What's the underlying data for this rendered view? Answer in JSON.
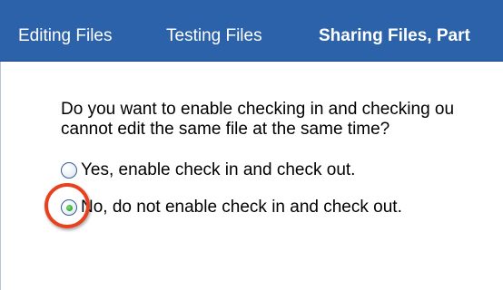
{
  "tabs": [
    {
      "label": "Editing Files",
      "active": false
    },
    {
      "label": "Testing Files",
      "active": false
    },
    {
      "label": "Sharing Files, Part",
      "active": true
    }
  ],
  "colors": {
    "tab_bar": "#2c62a9",
    "highlight_ring": "#e8411f",
    "radio_selected": "#2fa52f"
  },
  "question": {
    "line1": "Do you want to enable checking in and checking ou",
    "line2": "cannot edit the same file at the same time?"
  },
  "options": [
    {
      "label": "Yes, enable check in and check out.",
      "selected": false
    },
    {
      "label": "No, do not enable check in and check out.",
      "selected": true
    }
  ]
}
